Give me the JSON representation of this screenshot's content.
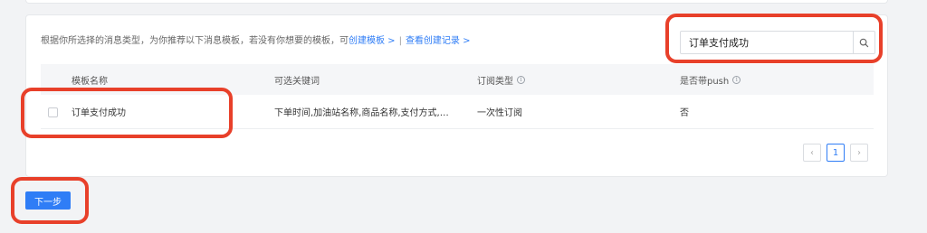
{
  "tip": {
    "text": "根据你所选择的消息类型，为你推荐以下消息模板，若没有你想要的模板，可",
    "create_link": "创建模板 >",
    "separator": "|",
    "records_link": "查看创建记录 >"
  },
  "search": {
    "value": "订单支付成功",
    "icon": "search-icon"
  },
  "table": {
    "headers": {
      "name": "模板名称",
      "keywords": "可选关键词",
      "sub_type": "订阅类型",
      "push": "是否带push"
    },
    "rows": [
      {
        "name": "订单支付成功",
        "keywords": "下单时间,加油站名称,商品名称,支付方式,支…",
        "sub_type": "一次性订阅",
        "push": "否"
      }
    ]
  },
  "pagination": {
    "prev": "‹",
    "current": "1",
    "next": "›"
  },
  "actions": {
    "next_step": "下一步"
  },
  "colors": {
    "accent": "#2f7df6",
    "highlight": "#e8402a"
  }
}
